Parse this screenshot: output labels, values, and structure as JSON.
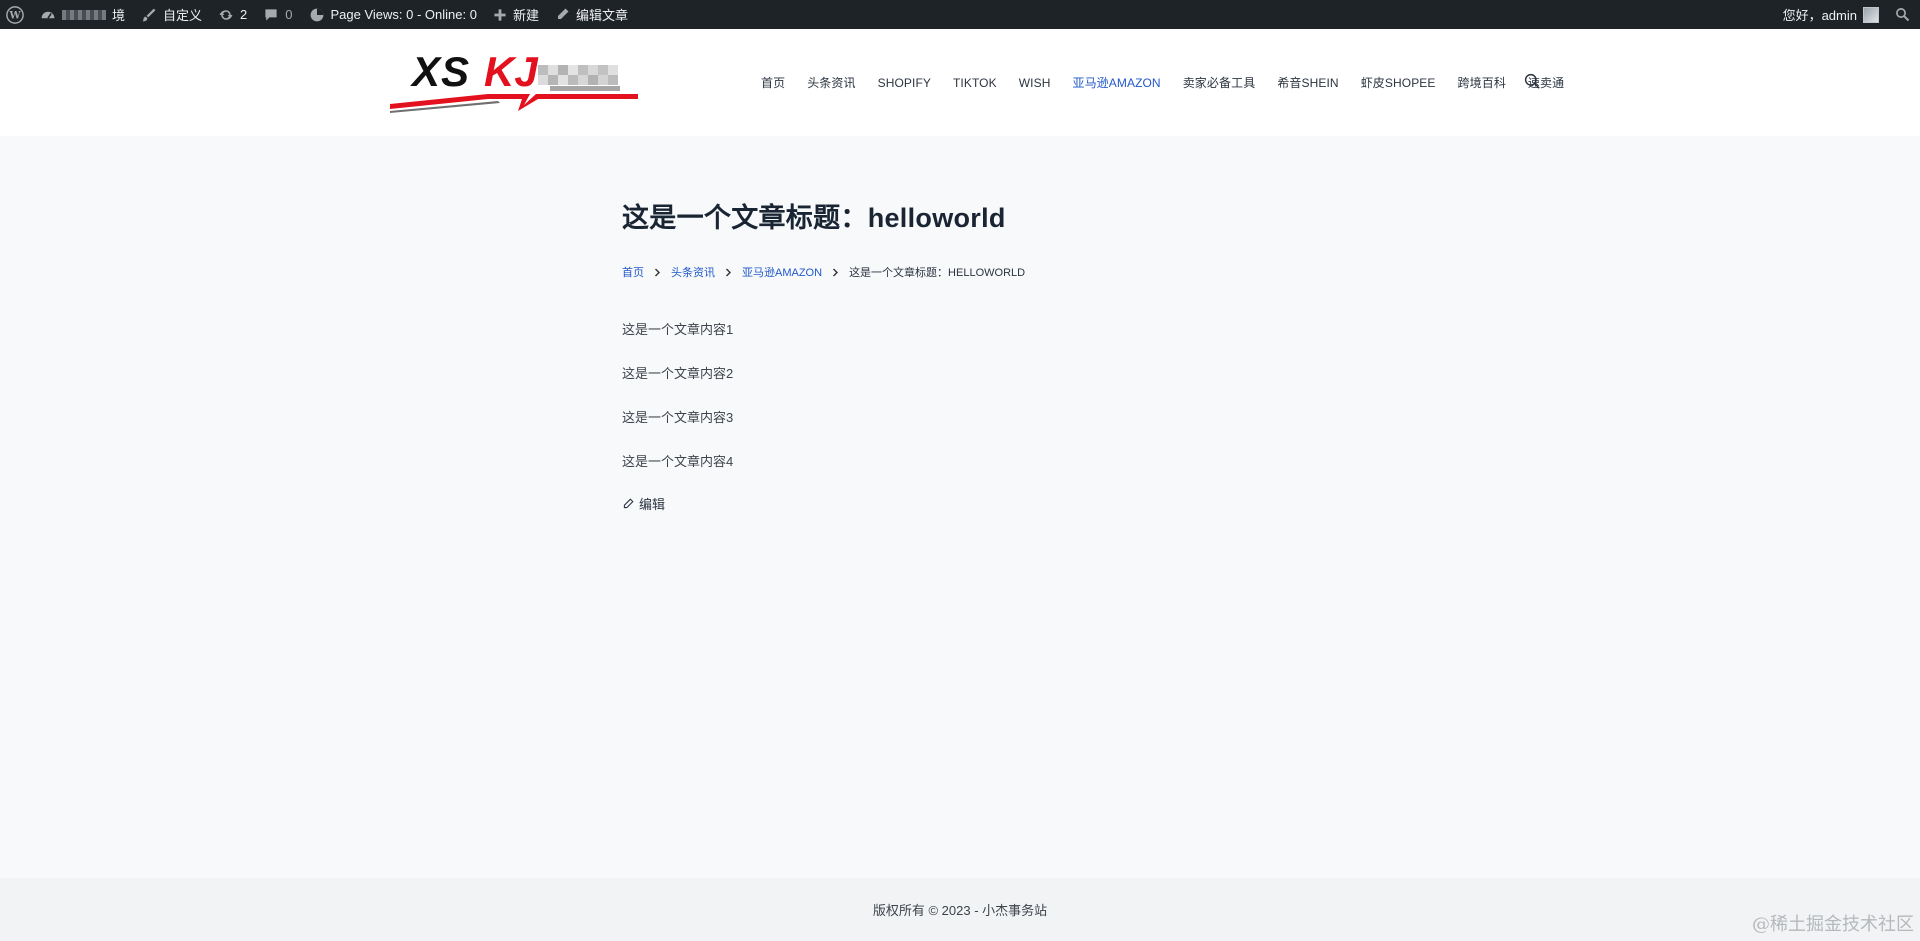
{
  "adminbar": {
    "site_suffix": "境",
    "customize": "自定义",
    "updates_count": "2",
    "comments_count": "0",
    "page_views": "Page Views: 0 - Online: 0",
    "new_label": "新建",
    "edit_post": "编辑文章",
    "greeting": "您好，admin"
  },
  "header": {
    "logo_text": "XSKJ",
    "nav": [
      "首页",
      "头条资讯",
      "SHOPIFY",
      "TIKTOK",
      "WISH",
      "亚马逊AMAZON",
      "卖家必备工具",
      "希音SHEIN",
      "虾皮SHOPEE",
      "跨境百科",
      "速卖通"
    ],
    "active_index": 5
  },
  "article": {
    "title": "这是一个文章标题：helloworld",
    "breadcrumb": {
      "home": "首页",
      "cat1": "头条资讯",
      "cat2": "亚马逊AMAZON",
      "current": "这是一个文章标题：HELLOWORLD"
    },
    "paragraphs": [
      "这是一个文章内容1",
      "这是一个文章内容2",
      "这是一个文章内容3",
      "这是一个文章内容4"
    ],
    "edit_label": "编辑"
  },
  "footer": {
    "copyright": "版权所有 © 2023 - 小杰事务站"
  },
  "watermark": "@稀土掘金技术社区",
  "colors": {
    "adminbar_bg": "#1d2327",
    "accent": "#2158c9",
    "logo_red": "#e3101d",
    "page_bg": "#f8f9fb"
  }
}
